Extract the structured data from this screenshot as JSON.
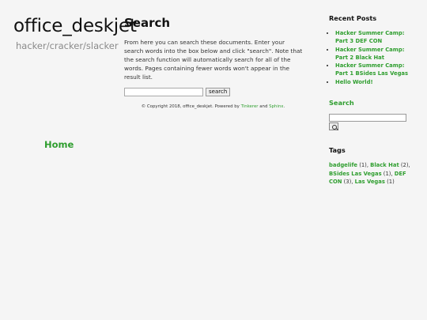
{
  "site": {
    "title": "office_deskjet",
    "tagline": "hacker/cracker/slacker",
    "home_link": "Home"
  },
  "main": {
    "heading": "Search",
    "intro": "From here you can search these documents. Enter your search words into the box below and click \"search\". Note that the search function will automatically search for all of the words. Pages containing fewer words won't appear in the result list.",
    "search_input_value": "",
    "search_button_label": "search"
  },
  "footer": {
    "copyright": "© Copyright 2018, office_deskjet. Powered by",
    "tinkerer": "Tinkerer",
    "and": "and",
    "sphinx": "Sphinx",
    "period": "."
  },
  "sidebar": {
    "recent_title": "Recent Posts",
    "recent_posts": [
      "Hacker Summer Camp: Part 3 DEF CON",
      "Hacker Summer Camp: Part 2 Black Hat",
      "Hacker Summer Camp: Part 1 BSides Las Vegas",
      "Hello World!"
    ],
    "search_title": "Search",
    "search_input_value": "",
    "tags_title": "Tags",
    "tags": [
      {
        "name": "badgelife",
        "count": "(1),"
      },
      {
        "name": "Black Hat",
        "count": "(2),"
      },
      {
        "name": "BSides Las Vegas",
        "count": "(1),"
      },
      {
        "name": "DEF CON",
        "count": "(3),"
      },
      {
        "name": "Las Vegas",
        "count": "(1)"
      }
    ]
  },
  "colors": {
    "link": "#2f9e2f",
    "background": "#f5f5f5",
    "tagline": "#8a8a8a"
  }
}
